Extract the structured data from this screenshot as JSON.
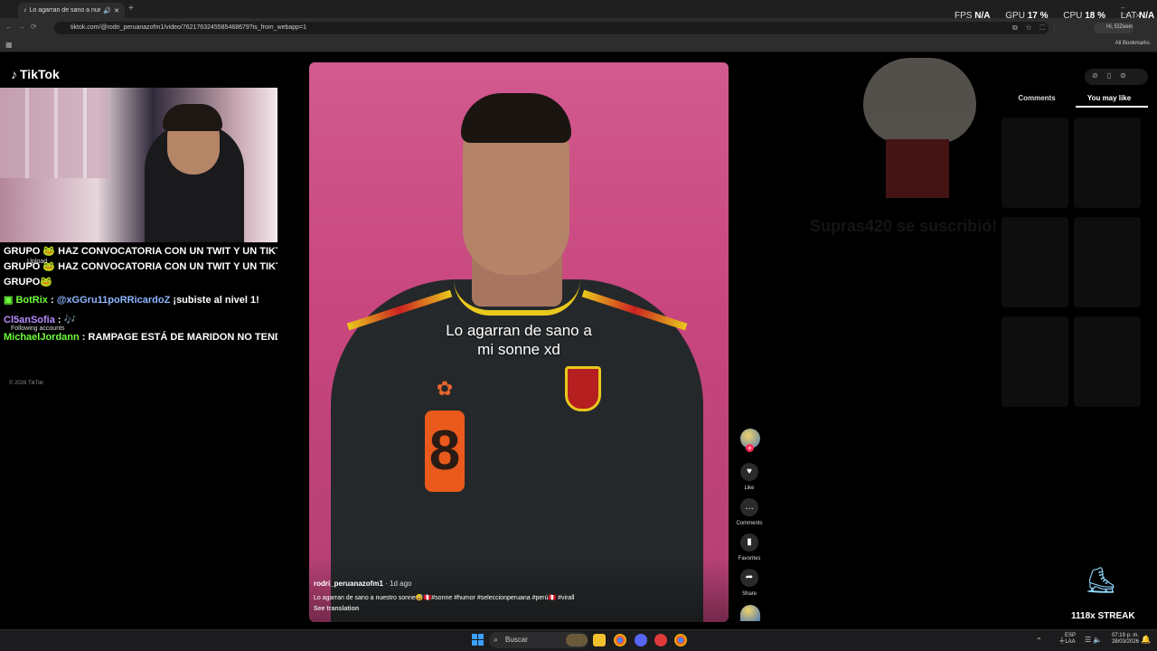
{
  "browser": {
    "tab_title": "Lo agarran de sano a nuest",
    "tab_close": "✕",
    "new_tab": "+",
    "url": "tiktok.com/@rodri_peruanazofm1/video/7621763245585468679?is_from_webapp=1",
    "profile": "Hi, ElZeein",
    "bookmarks": "All Bookmarks"
  },
  "stats": {
    "fps_label": "FPS",
    "fps": "N/A",
    "gpu_label": "GPU",
    "gpu": "17 %",
    "cpu_label": "CPU",
    "cpu": "18 %",
    "lat_label": "LAT",
    "lat": "N/A"
  },
  "tiktok": {
    "logo": "TikTok",
    "copyright": "© 2026 TikTok",
    "upload": "Upload",
    "following_accounts": "Following accounts"
  },
  "chat": [
    {
      "user": "GRUPO",
      "emote": "🐸",
      "text": "HAZ CONVOCATORIA CON UN TWIT Y UN TIKTO"
    },
    {
      "user": "GRUPO",
      "emote": "🐸",
      "text": "HAZ CONVOCATORIA CON UN TWIT Y UN TIKTO"
    },
    {
      "user": "GRUPO",
      "emote": "🐸",
      "text": ""
    },
    {
      "user": "BotRix",
      "emote": "",
      "text": "@xGGru11poRRicardoZ ¡subiste al nivel 1!"
    },
    {
      "user": "Cl5anSofia",
      "emote": "",
      "text": "🎶"
    },
    {
      "user": "MichaelJordann",
      "emote": "",
      "text": "RAMPAGE ESTÁ DE MARIDON NO TENDR"
    }
  ],
  "video": {
    "caption_line1": "Lo agarran de sano a",
    "caption_line2": "mi sonne xd",
    "jersey_number": "8",
    "author": "rodri_peruanazofm1",
    "time": " · 1d ago",
    "description": "Lo agarran de sano a nuestro sonne😅🇵🇪#sonne #humor #seleccionperuana #perú🇵🇪 #virall",
    "see_translation": "See translation"
  },
  "actions": {
    "like": "Like",
    "comments": "Comments",
    "favorites": "Favorites",
    "share": "Share"
  },
  "right_panel": {
    "tab_comments": "Comments",
    "tab_you_may_like": "You may like"
  },
  "overlay": {
    "subscription": "Supras420 se suscribió!",
    "streak": "1118x STREAK"
  },
  "taskbar": {
    "search": "Buscar",
    "lang_1": "ESP",
    "lang_2": "LAA",
    "time": "07:19 p. m.",
    "date": "28/03/2026"
  }
}
